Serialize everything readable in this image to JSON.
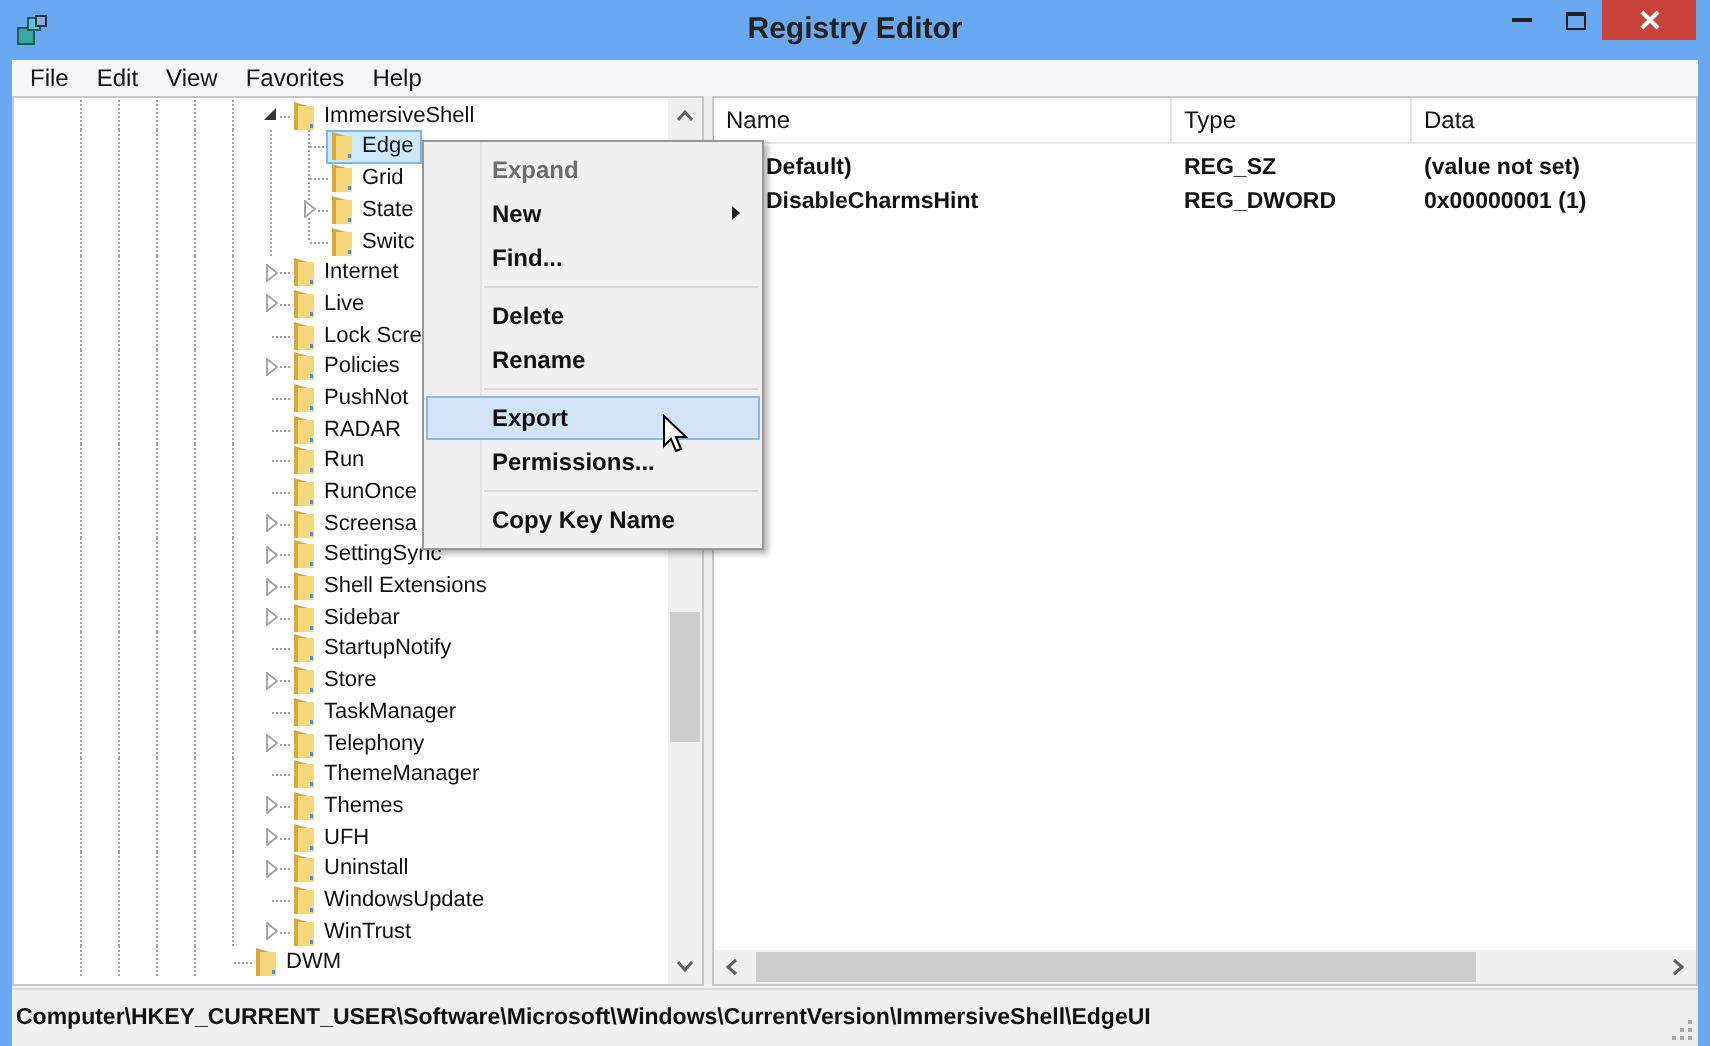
{
  "window": {
    "title": "Registry Editor"
  },
  "menu_bar": [
    {
      "label": "File"
    },
    {
      "label": "Edit"
    },
    {
      "label": "View"
    },
    {
      "label": "Favorites"
    },
    {
      "label": "Help"
    }
  ],
  "tree": {
    "items": [
      {
        "label": "ImmersiveShell",
        "expanded": true,
        "selected": false,
        "children": [
          {
            "label": "Edge",
            "selected": true
          },
          {
            "label": "Grid",
            "selected": false
          },
          {
            "label": "State",
            "expanded": false,
            "selected": false
          },
          {
            "label": "Switc",
            "selected": false
          }
        ]
      },
      {
        "label": "Internet",
        "expanded": false,
        "selected": false
      },
      {
        "label": "Live",
        "expanded": false,
        "selected": false
      },
      {
        "label": "Lock Scre",
        "selected": false
      },
      {
        "label": "Policies",
        "expanded": false,
        "selected": false
      },
      {
        "label": "PushNot",
        "selected": false
      },
      {
        "label": "RADAR",
        "selected": false
      },
      {
        "label": "Run",
        "selected": false
      },
      {
        "label": "RunOnce",
        "selected": false
      },
      {
        "label": "Screensa",
        "expanded": false,
        "selected": false
      },
      {
        "label": "SettingSync",
        "expanded": false,
        "selected": false
      },
      {
        "label": "Shell Extensions",
        "expanded": false,
        "selected": false
      },
      {
        "label": "Sidebar",
        "expanded": false,
        "selected": false
      },
      {
        "label": "StartupNotify",
        "selected": false
      },
      {
        "label": "Store",
        "expanded": false,
        "selected": false
      },
      {
        "label": "TaskManager",
        "selected": false
      },
      {
        "label": "Telephony",
        "expanded": false,
        "selected": false
      },
      {
        "label": "ThemeManager",
        "selected": false
      },
      {
        "label": "Themes",
        "expanded": false,
        "selected": false
      },
      {
        "label": "UFH",
        "expanded": false,
        "selected": false
      },
      {
        "label": "Uninstall",
        "expanded": false,
        "selected": false
      },
      {
        "label": "WindowsUpdate",
        "selected": false
      },
      {
        "label": "WinTrust",
        "expanded": false,
        "selected": false
      }
    ],
    "after_parent": [
      {
        "label": "DWM",
        "selected": false
      }
    ]
  },
  "values": {
    "columns": [
      "Name",
      "Type",
      "Data"
    ],
    "rows": [
      {
        "name": "Default)",
        "type": "REG_SZ",
        "data": "(value not set)"
      },
      {
        "name": "DisableCharmsHint",
        "type": "REG_DWORD",
        "data": "0x00000001 (1)"
      }
    ]
  },
  "context_menu": {
    "items": [
      {
        "kind": "item",
        "label": "Expand",
        "disabled": true,
        "submenu": false,
        "selected": false
      },
      {
        "kind": "item",
        "label": "New",
        "disabled": false,
        "submenu": true,
        "selected": false
      },
      {
        "kind": "item",
        "label": "Find...",
        "disabled": false,
        "submenu": false,
        "selected": false
      },
      {
        "kind": "separator"
      },
      {
        "kind": "item",
        "label": "Delete",
        "disabled": false,
        "submenu": false,
        "selected": false
      },
      {
        "kind": "item",
        "label": "Rename",
        "disabled": false,
        "submenu": false,
        "selected": false
      },
      {
        "kind": "separator"
      },
      {
        "kind": "item",
        "label": "Export",
        "disabled": false,
        "submenu": false,
        "selected": true
      },
      {
        "kind": "item",
        "label": "Permissions...",
        "disabled": false,
        "submenu": false,
        "selected": false
      },
      {
        "kind": "separator"
      },
      {
        "kind": "item",
        "label": "Copy Key Name",
        "disabled": false,
        "submenu": false,
        "selected": false
      }
    ]
  },
  "status_bar": {
    "path": "Computer\\HKEY_CURRENT_USER\\Software\\Microsoft\\Windows\\CurrentVersion\\ImmersiveShell\\EdgeUI"
  }
}
